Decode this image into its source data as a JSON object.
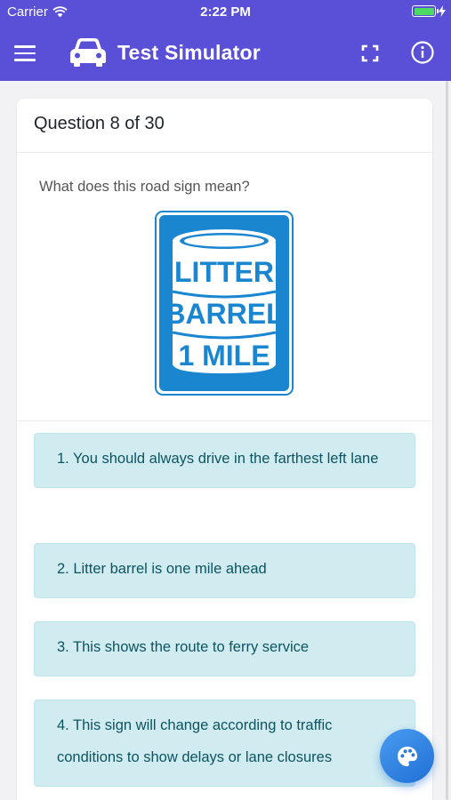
{
  "status_bar": {
    "carrier": "Carrier",
    "time": "2:22 PM"
  },
  "app_bar": {
    "title": "Test Simulator",
    "menu_icon": "hamburger-menu-icon",
    "logo_icon": "car-icon",
    "fullscreen_icon": "fullscreen-icon",
    "info_icon": "info-icon",
    "color": "#5a50d8"
  },
  "question": {
    "header": "Question 8 of 30",
    "text": "What does this road sign mean?",
    "sign": {
      "line1": "LITTER",
      "line2": "BARREL",
      "line3": "1 MILE",
      "color": "#1a86d0"
    }
  },
  "answers": [
    {
      "label": "1. You should always drive in the farthest left lane"
    },
    {
      "label": "2. Litter barrel is one mile ahead"
    },
    {
      "label": "3. This shows the route to ferry service"
    },
    {
      "label": "4. This sign will change according to traffic conditions to show delays or lane closures"
    }
  ],
  "fab": {
    "icon": "palette-icon"
  },
  "colors": {
    "answer_bg": "#d1ecf1",
    "answer_text": "#0c5460",
    "fab": "#2f86e8"
  }
}
